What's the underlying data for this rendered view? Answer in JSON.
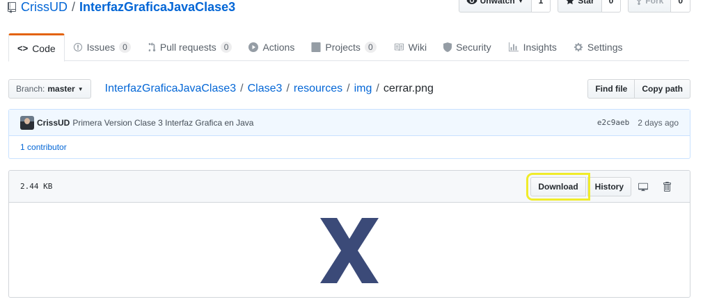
{
  "repo": {
    "owner": "CrissUD",
    "separator": "/",
    "name": "InterfazGraficaJavaClase3"
  },
  "actions": {
    "watch_label": "Unwatch",
    "watch_count": "1",
    "star_label": "Star",
    "star_count": "0",
    "fork_label": "Fork",
    "fork_count": "0"
  },
  "nav": {
    "code": "Code",
    "issues": "Issues",
    "issues_count": "0",
    "pulls": "Pull requests",
    "pulls_count": "0",
    "actions": "Actions",
    "projects": "Projects",
    "projects_count": "0",
    "wiki": "Wiki",
    "security": "Security",
    "insights": "Insights",
    "settings": "Settings"
  },
  "branch": {
    "prefix": "Branch:",
    "value": "master"
  },
  "breadcrumb": {
    "repo": "InterfazGraficaJavaClase3",
    "p1": "Clase3",
    "p2": "resources",
    "p3": "img",
    "file": "cerrar.png",
    "sep": "/"
  },
  "file_nav": {
    "find_file": "Find file",
    "copy_path": "Copy path"
  },
  "commit": {
    "author": "CrissUD",
    "message": "Primera Version Clase 3 Interfaz Grafica en Java",
    "sha": "e2c9aeb",
    "ago": "2 days ago",
    "contributors_num": "1",
    "contributors_label": "contributor"
  },
  "file": {
    "size": "2.44 KB",
    "download": "Download",
    "history": "History"
  },
  "colors": {
    "accent": "#e36209",
    "link": "#0366d6",
    "highlight": "#f0ec2a",
    "image_x": "#3b4a78"
  }
}
